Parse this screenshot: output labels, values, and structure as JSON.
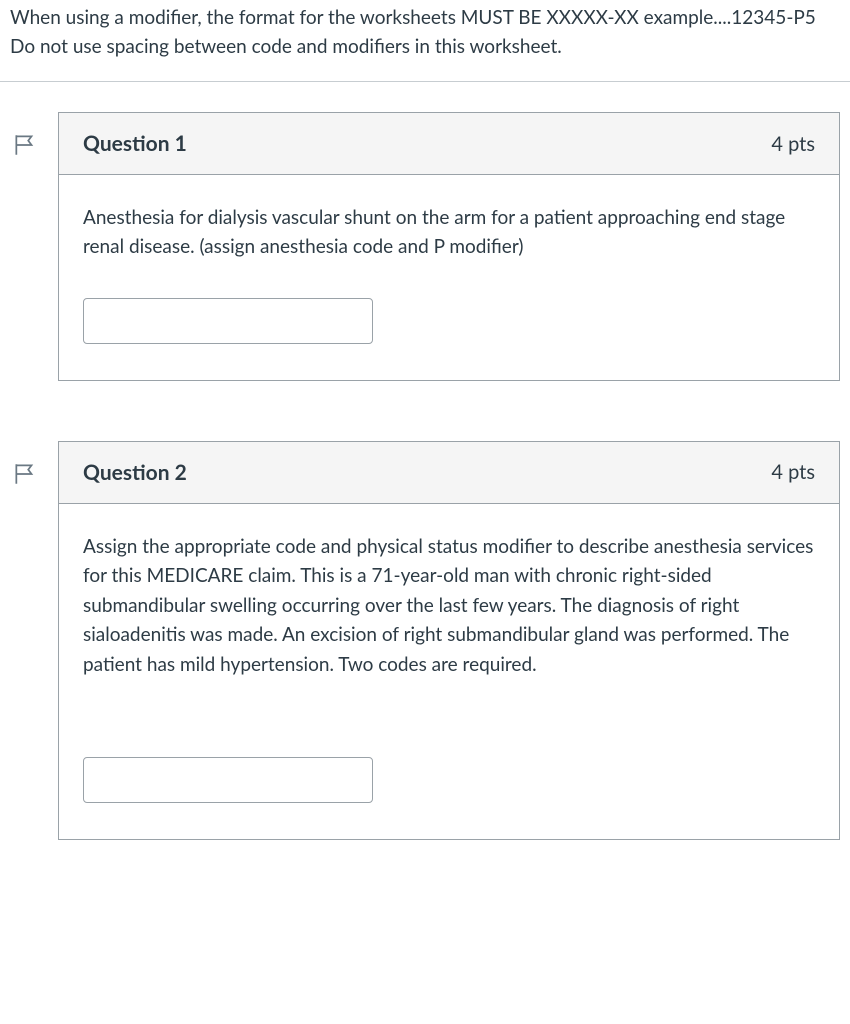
{
  "instructions": "When using a modifier, the format for the worksheets MUST BE   XXXXX-XX  example....12345-P5   Do not use spacing between code and modifiers in this worksheet.",
  "questions": [
    {
      "title": "Question 1",
      "points": "4 pts",
      "prompt": "Anesthesia for dialysis vascular shunt on the arm for a patient approaching end stage renal disease. (assign anesthesia code and P modifier)",
      "answer": ""
    },
    {
      "title": "Question 2",
      "points": "4 pts",
      "prompt": "Assign the appropriate code and physical status modifier to describe anesthesia services for this MEDICARE claim. This is a 71-year-old man with chronic right-sided submandibular swelling occurring over the last few years. The diagnosis of right sialoadenitis was made. An excision of right submandibular gland was performed. The patient has mild hypertension. Two codes are required.",
      "answer": ""
    }
  ]
}
